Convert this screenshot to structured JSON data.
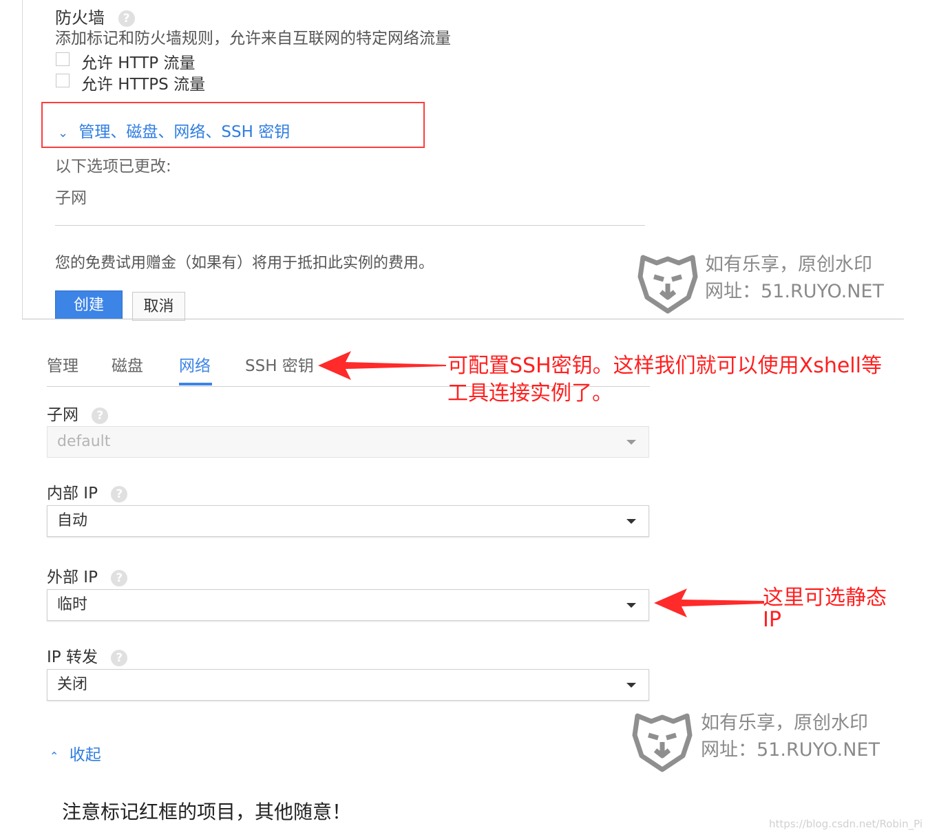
{
  "firewall": {
    "title": "防火墙",
    "description": "添加标记和防火墙规则，允许来自互联网的特定网络流量",
    "options": [
      {
        "label": "允许 HTTP 流量",
        "checked": false
      },
      {
        "label": "允许 HTTPS 流量",
        "checked": false
      }
    ]
  },
  "advanced": {
    "toggle_label": "管理、磁盘、网络、SSH 密钥",
    "changed_note": "以下选项已更改:",
    "changed_item": "子网",
    "free_trial_note": "您的免费试用赠金（如果有）将用于抵扣此实例的费用。",
    "create_button": "创建",
    "cancel_button": "取消"
  },
  "tabs": [
    {
      "label": "管理",
      "active": false
    },
    {
      "label": "磁盘",
      "active": false
    },
    {
      "label": "网络",
      "active": true
    },
    {
      "label": "SSH 密钥",
      "active": false
    }
  ],
  "network": {
    "subnet": {
      "label": "子网",
      "value": "default",
      "disabled": true
    },
    "internal_ip": {
      "label": "内部 IP",
      "value": "自动"
    },
    "external_ip": {
      "label": "外部 IP",
      "value": "临时"
    },
    "ip_forwarding": {
      "label": "IP 转发",
      "value": "关闭"
    },
    "collapse_label": "收起"
  },
  "annotations": {
    "ssh_note_line1": "可配置SSH密钥。这样我们就可以使用Xshell等",
    "ssh_note_line2": "工具连接实例了。",
    "ip_note_line1": "这里可选静态",
    "ip_note_line2": "IP"
  },
  "watermark": {
    "line1": "如有乐享，原创水印",
    "line2": "网址：51.RUYO.NET"
  },
  "footer_note": "注意标记红框的项目，其他随意！",
  "credit": "https://blog.csdn.net/Robin_Pi",
  "colors": {
    "accent": "#3c84e6",
    "annotation_red": "#ff1f1f",
    "link_blue": "#2f7de1"
  }
}
